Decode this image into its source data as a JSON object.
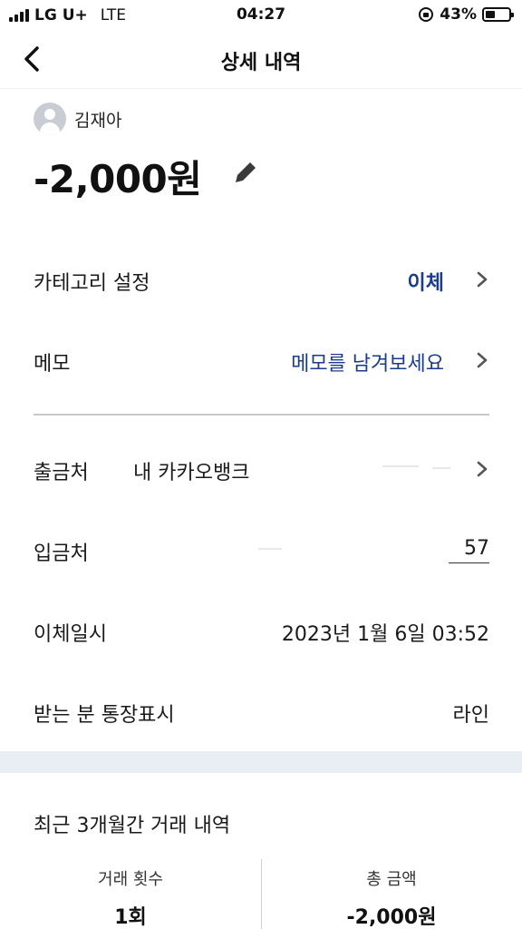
{
  "status_bar": {
    "carrier": "LG U+",
    "network": "LTE",
    "time": "04:27",
    "battery": "43%",
    "battery_level": 0.43
  },
  "nav": {
    "title": "상세 내역",
    "back_icon": "chevron-left-icon"
  },
  "profile": {
    "name": "김재아",
    "avatar_icon": "person-avatar-icon"
  },
  "amount": "-2,000원",
  "edit_icon": "pencil-icon",
  "rows": {
    "category": {
      "label": "카테고리 설정",
      "value": "이체"
    },
    "memo": {
      "label": "메모",
      "value": "메모를 남겨보세요"
    },
    "source": {
      "label": "출금처",
      "value": "내 카카오뱅크"
    },
    "destination": {
      "label": "입금처",
      "value": "57"
    },
    "datetime": {
      "label": "이체일시",
      "value": "2023년 1월 6일 03:52"
    },
    "recipient_display": {
      "label": "받는 분 통장표시",
      "value": "라인"
    }
  },
  "recent": {
    "title": "최근 3개월간 거래 내역",
    "count_label": "거래 횟수",
    "count_value": "1회",
    "total_label": "총 금액",
    "total_value": "-2,000원"
  },
  "colors": {
    "accent_blue": "#1a3c8c",
    "section_gap": "#e9eef5"
  }
}
